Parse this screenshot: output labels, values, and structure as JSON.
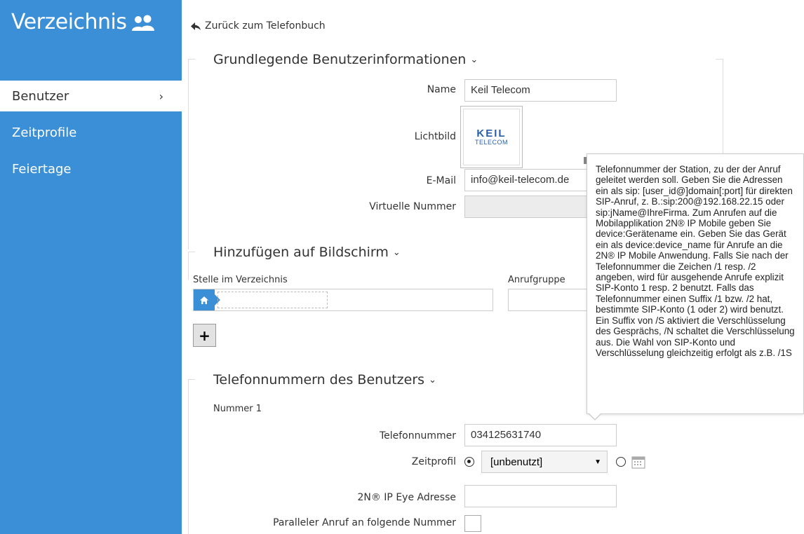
{
  "sidebar": {
    "title": "Verzeichnis",
    "items": [
      {
        "label": "Benutzer",
        "active": true
      },
      {
        "label": "Zeitprofile",
        "active": false
      },
      {
        "label": "Feiertage",
        "active": false
      }
    ]
  },
  "back_link": "Zurück zum Telefonbuch",
  "basic_info": {
    "title": "Grundlegende Benutzerinformationen",
    "name_label": "Name",
    "name_value": "Keil Telecom",
    "photo_label": "Lichtbild",
    "photo_logo_top": "KEIL",
    "photo_logo_bottom": "TELECOM",
    "email_label": "E-Mail",
    "email_value": "info@keil-telecom.de",
    "virtual_label": "Virtuelle Nummer",
    "virtual_value": ""
  },
  "screen": {
    "title": "Hinzufügen auf Bildschirm",
    "position_label": "Stelle im Verzeichnis",
    "group_label": "Anrufgruppe",
    "add_label": "+"
  },
  "phones": {
    "title": "Telefonnummern des Benutzers",
    "number_heading": "Nummer 1",
    "phone_label": "Telefonnummer",
    "phone_value": "034125631740",
    "timeprofile_label": "Zeitprofil",
    "timeprofile_value": "[unbenutzt]",
    "eye_label": "2N® IP Eye Adresse",
    "eye_value": "",
    "parallel_label": "Paralleler Anruf an folgende Nummer"
  },
  "tooltip": {
    "text": "Telefonnummer der Station, zu der der Anruf geleitet werden soll. Geben Sie die Adressen ein als sip: [user_id@]domain[:port] für direkten SIP-Anruf, z. B.:sip:200@192.168.22.15 oder sip:jName@IhreFirma. Zum Anrufen auf die Mobilapplikation 2N® IP Mobile geben Sie device:Gerätename ein. Geben Sie das Gerät ein als device:device_name für Anrufe an die 2N® IP Mobile Anwendung. Falls Sie nach der Telefonnummer die Zeichen /1 resp. /2 angeben, wird für ausgehende Anrufe explizit SIP-Konto 1 resp. 2 benutzt. Falls das Telefonnummer einen Suffix /1 bzw. /2 hat, bestimmte SIP-Konto (1 oder 2) wird benutzt. Ein Suffix von /S aktiviert die Verschlüsselung des Gesprächs, /N schaltet die Verschlüsselung aus. Die Wahl von SIP-Konto und Verschlüsselung gleichzeitig erfolgt als z.B. /1S"
  },
  "colors": {
    "sidebar": "#3a8fd6",
    "border": "#cccccc"
  }
}
